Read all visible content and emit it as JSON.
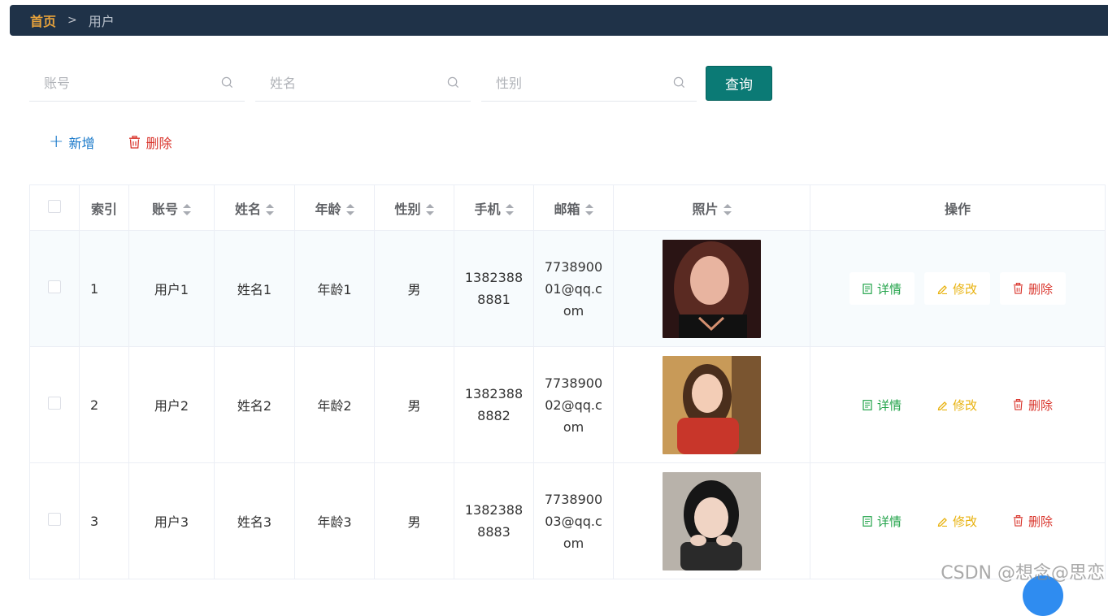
{
  "breadcrumb": {
    "home": "首页",
    "separator": ">",
    "current": "用户"
  },
  "search": {
    "account_placeholder": "账号",
    "name_placeholder": "姓名",
    "gender_placeholder": "性别",
    "query_label": "查询"
  },
  "actions": {
    "add_label": "新增",
    "delete_label": "删除"
  },
  "table": {
    "headers": {
      "index": "索引",
      "account": "账号",
      "name": "姓名",
      "age": "年龄",
      "gender": "性别",
      "phone": "手机",
      "email": "邮箱",
      "photo": "照片",
      "ops": "操作"
    },
    "rows": [
      {
        "index": "1",
        "account": "用户1",
        "name": "姓名1",
        "age": "年龄1",
        "gender": "男",
        "phone": "13823888881",
        "email": "773890001@qq.com"
      },
      {
        "index": "2",
        "account": "用户2",
        "name": "姓名2",
        "age": "年龄2",
        "gender": "男",
        "phone": "13823888882",
        "email": "773890002@qq.com"
      },
      {
        "index": "3",
        "account": "用户3",
        "name": "姓名3",
        "age": "年龄3",
        "gender": "男",
        "phone": "13823888883",
        "email": "773890003@qq.com"
      }
    ],
    "op_labels": {
      "detail": "详情",
      "edit": "修改",
      "delete": "删除"
    }
  },
  "watermark": "CSDN @想念@思恋",
  "colors": {
    "topbar": "#1f3248",
    "primary": "#0b7a75",
    "detail": "#22a34a",
    "edit": "#e8b10c",
    "danger": "#d9342b",
    "link": "#1677c9"
  }
}
